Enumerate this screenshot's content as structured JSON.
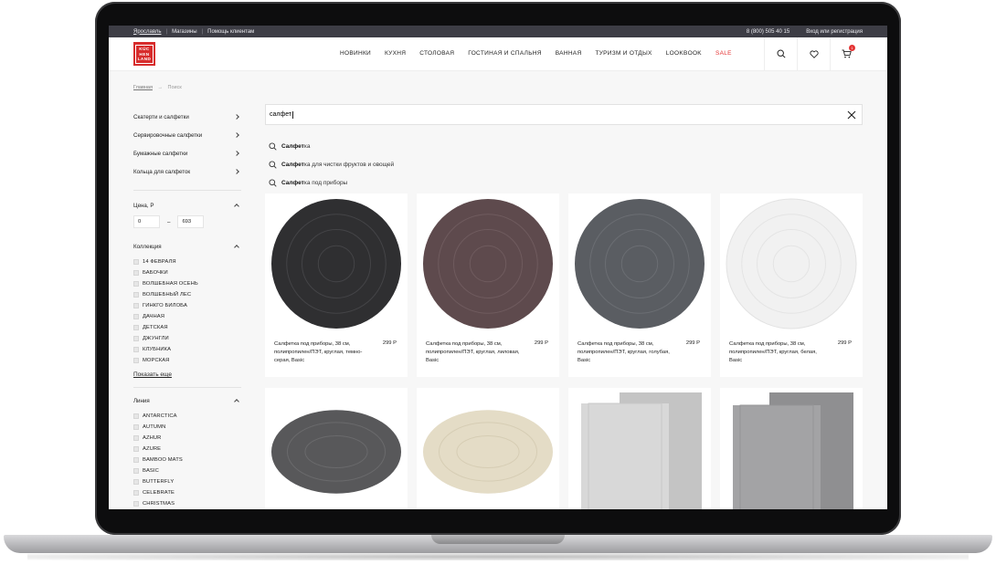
{
  "topbar": {
    "city": "Ярославль",
    "stores": "Магазины",
    "help": "Помощь клиентам",
    "phone": "8 (800) 505 40 15",
    "login": "Вход или регистрация"
  },
  "logo": {
    "line1": "KÜC",
    "line2": "HEN",
    "line3": "LAND"
  },
  "nav": [
    "НОВИНКИ",
    "КУХНЯ",
    "СТОЛОВАЯ",
    "ГОСТИНАЯ И СПАЛЬНЯ",
    "ВАННАЯ",
    "ТУРИЗМ И ОТДЫХ",
    "LOOKBOOK",
    "SALE"
  ],
  "cart_count": "1",
  "breadcrumb": {
    "home": "Главная",
    "arrow": "→",
    "current": "Поиск"
  },
  "categories": [
    "Скатерти и салфетки",
    "Сервировочные салфетки",
    "Бумажные салфетки",
    "Кольца для салфеток"
  ],
  "price_filter": {
    "label": "Цена, Р",
    "min": "0",
    "dash": "–",
    "max": "693"
  },
  "collection_filter": {
    "label": "Коллекция",
    "options": [
      "14 ФЕВРАЛЯ",
      "БАБОЧКИ",
      "ВОЛШЕБНАЯ ОСЕНЬ",
      "ВОЛШЕБНЫЙ ЛЕС",
      "ГИНКГО БИЛОБА",
      "ДАЧНАЯ",
      "ДЕТСКАЯ",
      "ДЖУНГЛИ",
      "КЛУБНИКА",
      "МОРСКАЯ"
    ],
    "show_more": "Показать еще"
  },
  "line_filter": {
    "label": "Линия",
    "options": [
      "ANTARCTICA",
      "AUTUMN",
      "AZHUR",
      "AZURE",
      "BAMBOO MATS",
      "BASIC",
      "BUTTERFLY",
      "CELEBRATE",
      "CHRISTMAS"
    ]
  },
  "search": {
    "query": "салфет",
    "suggestions": [
      {
        "bold": "Салфет",
        "rest": "ка"
      },
      {
        "bold": "Салфет",
        "rest": "ка для чистки фруктов и овощей"
      },
      {
        "bold": "Салфет",
        "rest": "ка под приборы"
      }
    ]
  },
  "products": [
    {
      "title": "Салфетка под приборы, 38 см, полипропилен/ПЭТ, круглая, темно-серая, Basic",
      "price": "299 Р",
      "shape": "round",
      "color": "#2f2f31"
    },
    {
      "title": "Салфетка под приборы, 38 см, полипропилен/ПЭТ, круглая, лиловая, Basic",
      "price": "299 Р",
      "shape": "round",
      "color": "#5e4a4d"
    },
    {
      "title": "Салфетка под приборы, 38 см, полипропилен/ПЭТ, круглая, голубая, Basic",
      "price": "299 Р",
      "shape": "round",
      "color": "#5a5d62"
    },
    {
      "title": "Салфетка под приборы, 38 см, полипропилен/ПЭТ, круглая, белая, Basic",
      "price": "299 Р",
      "shape": "round",
      "color": "#f3f3f3"
    },
    {
      "title": "",
      "price": "",
      "shape": "oval",
      "color": "#58585a"
    },
    {
      "title": "",
      "price": "",
      "shape": "oval",
      "color": "#e4dcc6"
    },
    {
      "title": "",
      "price": "",
      "shape": "rect",
      "color": "#d2d2d2"
    },
    {
      "title": "",
      "price": "",
      "shape": "rect",
      "color": "#9d9d9f"
    }
  ],
  "colors": {
    "accent": "#d72c2c",
    "topbar": "#3d3d45",
    "sale": "#e43333"
  }
}
